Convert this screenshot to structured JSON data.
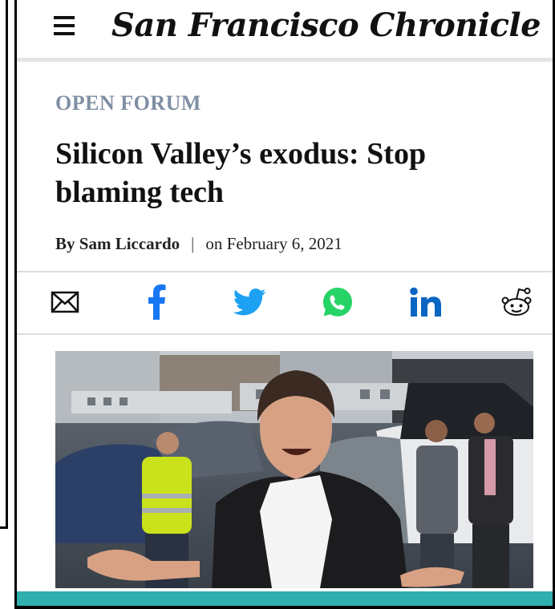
{
  "header": {
    "masthead": "San Francisco Chronicle",
    "menu_icon": "hamburger-menu-icon"
  },
  "article": {
    "section": "OPEN FORUM",
    "headline": "Silicon Valley’s exodus: Stop blaming tech",
    "byline_prefix": "By ",
    "author": "Sam Liccardo",
    "separator": "|",
    "date": "on February 6, 2021"
  },
  "share": {
    "icons": [
      "email-icon",
      "facebook-icon",
      "twitter-icon",
      "whatsapp-icon",
      "linkedin-icon",
      "reddit-icon"
    ],
    "colors": {
      "facebook": "#1877f2",
      "twitter": "#1da1f2",
      "whatsapp": "#25d366",
      "linkedin": "#0a66c2"
    }
  },
  "colors": {
    "section_label": "#7f8fa4",
    "accent_bar": "#2fb0ae"
  }
}
